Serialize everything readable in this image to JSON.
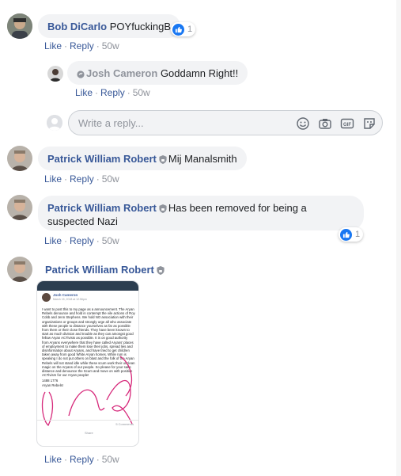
{
  "comments": [
    {
      "author": "Bob DiCarlo",
      "text": "POYfuckingB",
      "reactions": "1",
      "actions": {
        "like": "Like",
        "reply": "Reply",
        "time": "50w"
      }
    },
    {
      "author": "Josh Cameron",
      "text": "Goddamn Right!!",
      "actions": {
        "like": "Like",
        "reply": "Reply",
        "time": "50w"
      }
    },
    {
      "author": "Patrick William Robert",
      "text": "Mij Manalsmith",
      "actions": {
        "like": "Like",
        "reply": "Reply",
        "time": "50w"
      }
    },
    {
      "author": "Patrick William Robert",
      "text": "Has been removed for being a suspected Nazi",
      "reactions": "1",
      "actions": {
        "like": "Like",
        "reply": "Reply",
        "time": "50w"
      }
    },
    {
      "author": "Patrick William Robert",
      "actions": {
        "like": "Like",
        "reply": "Reply",
        "time": "50w"
      }
    }
  ],
  "reply_box": {
    "placeholder": "Write a reply..."
  },
  "screenshot": {
    "author": "Josh Cameron",
    "date": "March 15, 2018 at 12:56pm",
    "body": "I want to post this to my page as a announcement. The Aryan Rebels denounce and hold in contempt the vile actions of Roy Cobb and Jenn Stephens. We hold NO association with their organizations or groups and strongly urge all who associate with these people to distance yourselves as far as possible from them or their close friends. They have been known to start as much division and trouble as they can amongst good fellow Aryan ACTivists as possible. It is on good authority from Aryans everywhere that they have called Aryans' places of employment to make them lose their jobs, spread lies and disinformation about Aryans, and have tried to get children taken away from good White Aryan homes. While rum is speaking I do not put others on blast and the folk of the Aryan Rebels will not stand idle while these scum work their unclean magic on the Aryans of our people. So please for your sake distance and denounce the Scum and move on with positive ACTivism for our Aryan people!",
    "sign1": "1488 1776",
    "sign2": "Aryan Rebels!",
    "comments_count": "5 Comments",
    "share": "Share"
  },
  "colors": {
    "link": "#385898",
    "bubble": "#f2f3f5",
    "like": "#1877f2",
    "meta": "#90949c"
  }
}
